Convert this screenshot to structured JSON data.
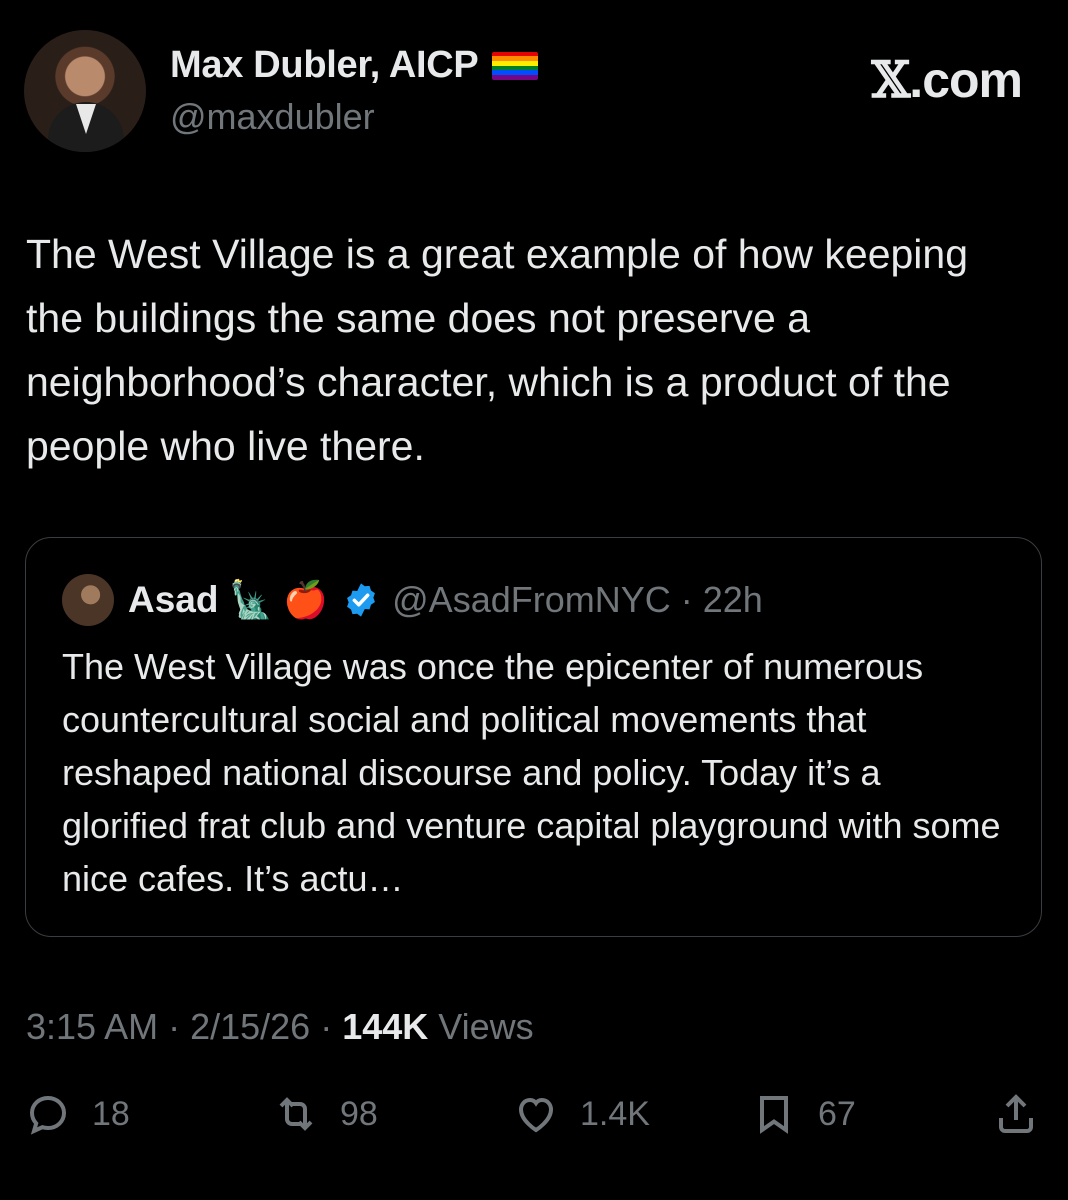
{
  "author": {
    "display_name": "Max Dubler, AICP",
    "handle": "@maxdubler",
    "flag_emoji": "🏳️‍🌈",
    "avatar": "profile-photo"
  },
  "brand": {
    "x_glyph": "𝕏",
    "domain": ".com"
  },
  "tweet": {
    "text": "The West Village is a great example of how keeping the buildings the same does not preserve a neighborhood’s character, which is a product of the people who live there."
  },
  "quote": {
    "author_name": "Asad",
    "emoji_1": "🗽",
    "emoji_2": "🍎",
    "verified_icon": "verified-badge-icon",
    "handle_time": "@AsadFromNYC · 22h",
    "text": "The West Village was once the epicenter of numerous countercultural social and political movements that reshaped national discourse and policy. Today it’s a glorified frat club and venture capital playground with some nice cafes. It’s actu…"
  },
  "meta": {
    "time_date": "3:15 AM · 2/15/26 · ",
    "views_count": "144K",
    "views_label": " Views"
  },
  "actions": {
    "replies": "18",
    "reposts": "98",
    "likes": "1.4K",
    "bookmarks": "67"
  },
  "colors": {
    "background": "#000000",
    "text": "#e7e9ea",
    "secondary": "#71767b",
    "verified": "#1d9bf0"
  }
}
